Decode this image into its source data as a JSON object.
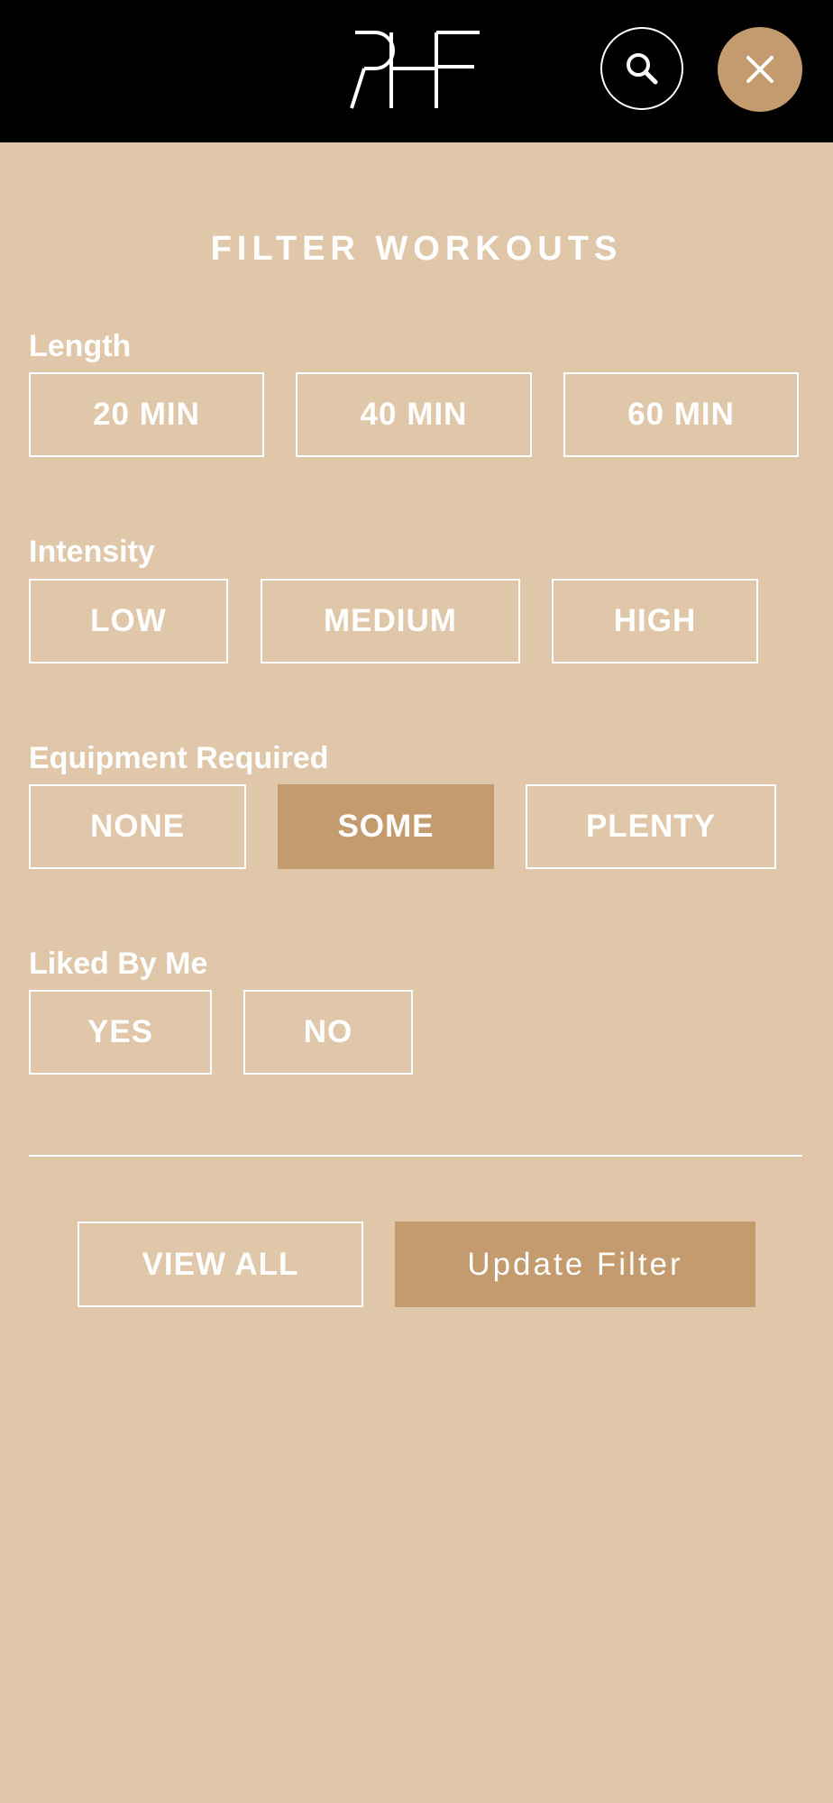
{
  "header": {
    "logo_text": "RHF",
    "search_icon": "search-icon",
    "close_icon": "close-icon"
  },
  "title": "FILTER WORKOUTS",
  "filters": {
    "length": {
      "label": "Length",
      "options": [
        "20 MIN",
        "40 MIN",
        "60 MIN"
      ]
    },
    "intensity": {
      "label": "Intensity",
      "options": [
        "LOW",
        "MEDIUM",
        "HIGH"
      ]
    },
    "equipment": {
      "label": "Equipment Required",
      "options": [
        "NONE",
        "SOME",
        "PLENTY"
      ],
      "selected": "SOME"
    },
    "liked": {
      "label": "Liked By Me",
      "options": [
        "YES",
        "NO"
      ]
    }
  },
  "actions": {
    "view_all": "VIEW ALL",
    "update": "Update Filter"
  },
  "colors": {
    "background": "#e0c7aa",
    "accent": "#c49b6e",
    "header": "#000000"
  }
}
